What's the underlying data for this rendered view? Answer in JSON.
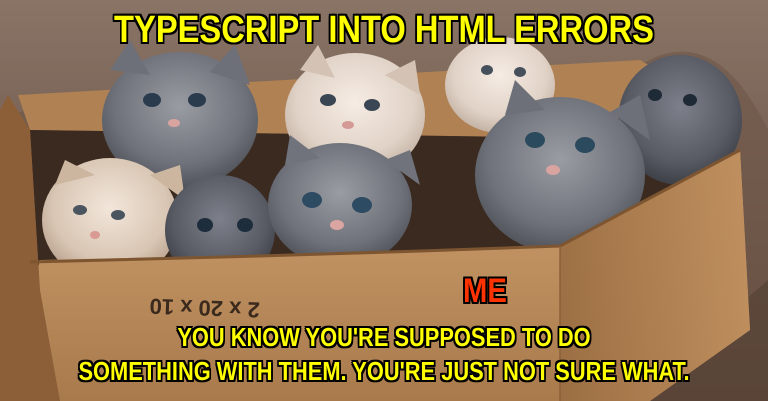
{
  "meme": {
    "top_caption": "TYPESCRIPT INTO HTML ERRORS",
    "me_label": "ME",
    "bottom_caption": {
      "line1": "YOU KNOW YOU'RE SUPPOSED TO DO",
      "line2": "SOMETHING WITH THEM.  YOU'RE JUST NOT SURE WHAT."
    },
    "box_print": "2 x 20 x 10"
  },
  "colors": {
    "top_caption": "#ffff00",
    "me_label": "#ff3300",
    "bottom_caption": "#ffff00",
    "box": "#c69464"
  }
}
